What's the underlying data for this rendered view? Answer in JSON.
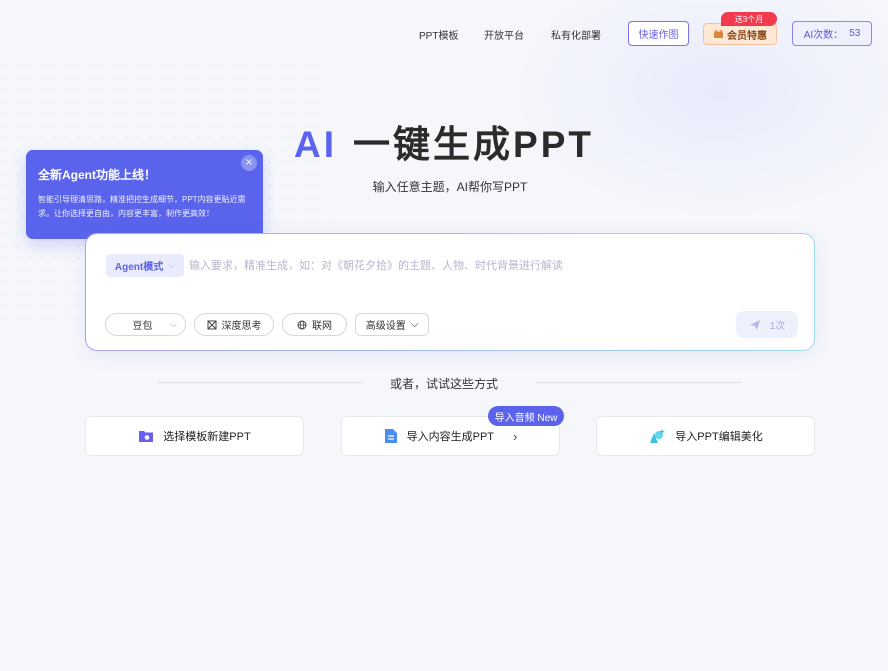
{
  "nav": {
    "links": [
      "PPT模板",
      "开放平台",
      "私有化部署"
    ],
    "quick_draw": "快速作图",
    "vip_tag": "送3个月",
    "vip_label": "会员特惠",
    "ai_count_label": "AI次数：",
    "ai_count_value": "53"
  },
  "hero": {
    "title_ai": "AI",
    "title_main": "一键生成PPT",
    "subtitle": "输入任意主题，AI帮你写PPT"
  },
  "tooltip": {
    "title": "全新Agent功能上线！",
    "body": "智能引导理清思路，精准把控生成细节，PPT内容更贴近需求。让你选择更自由，内容更丰富，制作更高效！",
    "close": "×"
  },
  "input_card": {
    "mode_label": "Agent模式",
    "placeholder": "输入要求，精准生成，如：对《朝花夕拾》的主题、人物、时代背景进行解读",
    "model_select": "豆包",
    "deep_think": "深度思考",
    "web_search": "联网",
    "advanced": "高级设置",
    "send_count": "1次"
  },
  "alternatives": {
    "divider_text": "或者，试试这些方式",
    "options": [
      {
        "label": "选择模板新建PPT"
      },
      {
        "label": "导入内容生成PPT",
        "badge": "导入音频 New"
      },
      {
        "label": "导入PPT编辑美化"
      }
    ]
  },
  "colors": {
    "accent": "#5b63ec",
    "vip_bg": "#fde9d6",
    "vip_tag": "#f23a4e"
  },
  "icons": [
    "crown-icon",
    "close-icon",
    "chevron-down-icon",
    "atom-icon",
    "globe-icon",
    "send-icon",
    "folder-icon",
    "document-icon",
    "magic-wand-icon",
    "chevron-right-icon"
  ]
}
